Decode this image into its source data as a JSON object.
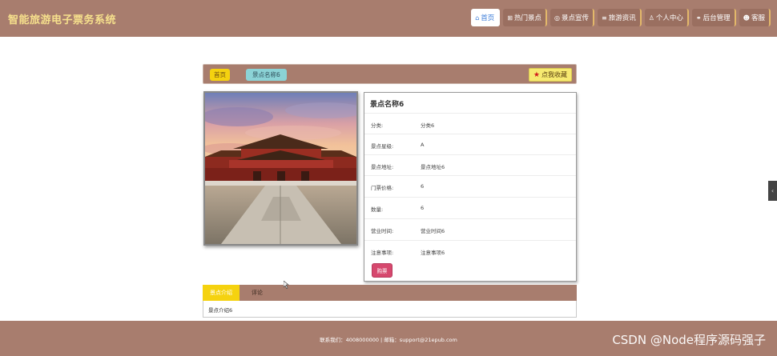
{
  "header": {
    "brand": "智能旅游电子票务系统",
    "nav": [
      {
        "label": "首页",
        "icon": "home-icon",
        "glyph": "⌂",
        "active": true
      },
      {
        "label": "热门景点",
        "icon": "grid-icon",
        "glyph": "⊞",
        "active": false
      },
      {
        "label": "景点宣传",
        "icon": "eye-icon",
        "glyph": "◎",
        "active": false
      },
      {
        "label": "旅游资讯",
        "icon": "list-icon",
        "glyph": "≡",
        "active": false
      },
      {
        "label": "个人中心",
        "icon": "user-icon",
        "glyph": "♙",
        "active": false
      },
      {
        "label": "后台管理",
        "icon": "link-icon",
        "glyph": "⚭",
        "active": false
      },
      {
        "label": "客服",
        "icon": "support-icon",
        "glyph": "☻",
        "active": false
      }
    ]
  },
  "breadcrumb": {
    "home": "首页",
    "current": "景点名称6",
    "favorite": "点我收藏"
  },
  "detail": {
    "title": "景点名称6",
    "rows": [
      {
        "label": "分类:",
        "value": "分类6"
      },
      {
        "label": "景点星级:",
        "value": "A"
      },
      {
        "label": "景点地址:",
        "value": "景点地址6"
      },
      {
        "label": "门票价格:",
        "value": "6"
      },
      {
        "label": "数量:",
        "value": "6"
      },
      {
        "label": "营业时间:",
        "value": "营业时间6"
      },
      {
        "label": "注意事项:",
        "value": "注意事项6"
      }
    ],
    "buy": "购票"
  },
  "tabs": {
    "items": [
      "景点介绍",
      "评论"
    ],
    "content": "景点介绍6"
  },
  "footer": {
    "text": "联系我们：4008000000 | 邮箱：support@21epub.com",
    "watermark": "CSDN @Node程序源码强子"
  },
  "colors": {
    "primary": "#a87d6e",
    "accent_yellow": "#f5d20f",
    "buy_pink": "#d6486e"
  }
}
